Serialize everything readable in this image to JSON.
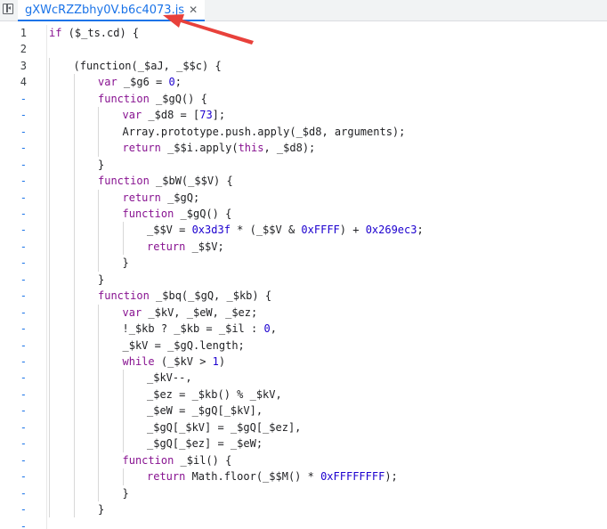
{
  "tab": {
    "filename": "gXWcRZZbhy0V.b6c4073.js",
    "close_glyph": "✕"
  },
  "icons": {
    "panel_toggle": "sidebar-panel-icon",
    "annotation_arrow": "red-arrow"
  },
  "colors": {
    "tab_accent": "#1a73e8",
    "arrow": "#e8413b",
    "keyword": "#881391",
    "number": "#1c00cf"
  },
  "lines": [
    {
      "n": "1",
      "indent": 0,
      "tokens": [
        [
          "kw",
          "if"
        ],
        [
          "t",
          " ($_ts.cd) {"
        ]
      ]
    },
    {
      "n": "2",
      "indent": 0,
      "tokens": []
    },
    {
      "n": "3",
      "indent": 1,
      "tokens": [
        [
          "t",
          "(function(_$aJ, _$$c) {"
        ]
      ]
    },
    {
      "n": "4",
      "indent": 2,
      "tokens": [
        [
          "kw",
          "var"
        ],
        [
          "t",
          " _$g6 = "
        ],
        [
          "num",
          "0"
        ],
        [
          "t",
          ";"
        ]
      ]
    },
    {
      "n": "-",
      "indent": 2,
      "tokens": [
        [
          "kw",
          "function"
        ],
        [
          "t",
          " _$gQ() {"
        ]
      ]
    },
    {
      "n": "-",
      "indent": 3,
      "tokens": [
        [
          "kw",
          "var"
        ],
        [
          "t",
          " _$d8 = ["
        ],
        [
          "num",
          "73"
        ],
        [
          "t",
          "];"
        ]
      ]
    },
    {
      "n": "-",
      "indent": 3,
      "tokens": [
        [
          "t",
          "Array.prototype.push.apply(_$d8, arguments);"
        ]
      ]
    },
    {
      "n": "-",
      "indent": 3,
      "tokens": [
        [
          "kw",
          "return"
        ],
        [
          "t",
          " _$$i.apply("
        ],
        [
          "kw",
          "this"
        ],
        [
          "t",
          ", _$d8);"
        ]
      ]
    },
    {
      "n": "-",
      "indent": 2,
      "tokens": [
        [
          "t",
          "}"
        ]
      ]
    },
    {
      "n": "-",
      "indent": 2,
      "tokens": [
        [
          "kw",
          "function"
        ],
        [
          "t",
          " _$bW(_$$V) {"
        ]
      ]
    },
    {
      "n": "-",
      "indent": 3,
      "tokens": [
        [
          "kw",
          "return"
        ],
        [
          "t",
          " _$gQ;"
        ]
      ]
    },
    {
      "n": "-",
      "indent": 3,
      "tokens": [
        [
          "kw",
          "function"
        ],
        [
          "t",
          " _$gQ() {"
        ]
      ]
    },
    {
      "n": "-",
      "indent": 4,
      "tokens": [
        [
          "t",
          "_$$V = "
        ],
        [
          "num",
          "0x3d3f"
        ],
        [
          "t",
          " * (_$$V & "
        ],
        [
          "num",
          "0xFFFF"
        ],
        [
          "t",
          ") + "
        ],
        [
          "num",
          "0x269ec3"
        ],
        [
          "t",
          ";"
        ]
      ]
    },
    {
      "n": "-",
      "indent": 4,
      "tokens": [
        [
          "kw",
          "return"
        ],
        [
          "t",
          " _$$V;"
        ]
      ]
    },
    {
      "n": "-",
      "indent": 3,
      "tokens": [
        [
          "t",
          "}"
        ]
      ]
    },
    {
      "n": "-",
      "indent": 2,
      "tokens": [
        [
          "t",
          "}"
        ]
      ]
    },
    {
      "n": "-",
      "indent": 2,
      "tokens": [
        [
          "kw",
          "function"
        ],
        [
          "t",
          " _$bq(_$gQ, _$kb) {"
        ]
      ]
    },
    {
      "n": "-",
      "indent": 3,
      "tokens": [
        [
          "kw",
          "var"
        ],
        [
          "t",
          " _$kV, _$eW, _$ez;"
        ]
      ]
    },
    {
      "n": "-",
      "indent": 3,
      "tokens": [
        [
          "t",
          "!_$kb ? _$kb = _$il : "
        ],
        [
          "num",
          "0"
        ],
        [
          "t",
          ","
        ]
      ]
    },
    {
      "n": "-",
      "indent": 3,
      "tokens": [
        [
          "t",
          "_$kV = _$gQ.length;"
        ]
      ]
    },
    {
      "n": "-",
      "indent": 3,
      "tokens": [
        [
          "kw",
          "while"
        ],
        [
          "t",
          " (_$kV > "
        ],
        [
          "num",
          "1"
        ],
        [
          "t",
          ")"
        ]
      ]
    },
    {
      "n": "-",
      "indent": 4,
      "tokens": [
        [
          "t",
          "_$kV--,"
        ]
      ]
    },
    {
      "n": "-",
      "indent": 4,
      "tokens": [
        [
          "t",
          "_$ez = _$kb() % _$kV,"
        ]
      ]
    },
    {
      "n": "-",
      "indent": 4,
      "tokens": [
        [
          "t",
          "_$eW = _$gQ[_$kV],"
        ]
      ]
    },
    {
      "n": "-",
      "indent": 4,
      "tokens": [
        [
          "t",
          "_$gQ[_$kV] = _$gQ[_$ez],"
        ]
      ]
    },
    {
      "n": "-",
      "indent": 4,
      "tokens": [
        [
          "t",
          "_$gQ[_$ez] = _$eW;"
        ]
      ]
    },
    {
      "n": "-",
      "indent": 3,
      "tokens": [
        [
          "kw",
          "function"
        ],
        [
          "t",
          " _$il() {"
        ]
      ]
    },
    {
      "n": "-",
      "indent": 4,
      "tokens": [
        [
          "kw",
          "return"
        ],
        [
          "t",
          " Math.floor(_$$M() * "
        ],
        [
          "num",
          "0xFFFFFFFF"
        ],
        [
          "t",
          ");"
        ]
      ]
    },
    {
      "n": "-",
      "indent": 3,
      "tokens": [
        [
          "t",
          "}"
        ]
      ]
    },
    {
      "n": "-",
      "indent": 2,
      "tokens": [
        [
          "t",
          "}"
        ]
      ]
    },
    {
      "n": "-",
      "indent": 0,
      "tokens": []
    }
  ]
}
